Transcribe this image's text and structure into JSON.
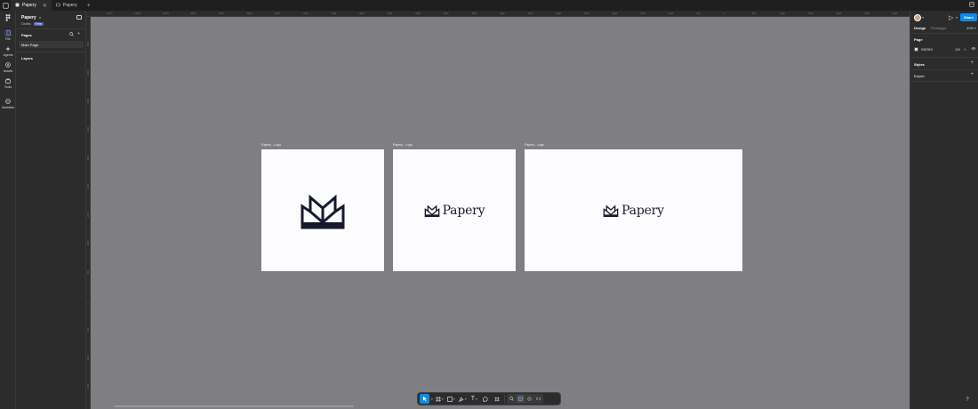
{
  "titlebar": {
    "tabs": [
      {
        "label": "Papery",
        "active": true
      },
      {
        "label": "Papery",
        "active": false
      }
    ]
  },
  "rail": {
    "items": [
      {
        "label": "File",
        "icon": "file-icon",
        "active": true
      },
      {
        "label": "Agents",
        "icon": "sparkle-icon"
      },
      {
        "label": "Assets",
        "icon": "assets-icon"
      },
      {
        "label": "Tools",
        "icon": "tools-icon"
      },
      {
        "label": "Variables",
        "icon": "variables-icon"
      }
    ]
  },
  "left_panel": {
    "project_name": "Papery",
    "drafts_label": "Drafts",
    "plan_badge": "Free",
    "pages_label": "Pages",
    "pages": [
      "Main Page"
    ],
    "layers_label": "Layers"
  },
  "ruler": {
    "h_ticks": [
      "-11000",
      "-10500",
      "-10000",
      "-9500",
      "-9000",
      "-8500",
      "-8000",
      "-7500",
      "-7000",
      "-6500",
      "-6000",
      "-5500",
      "-5000",
      "-4500",
      "-4000",
      "-3500",
      "-3000",
      "-2500",
      "-2000",
      "-1500",
      "-1000",
      "-500",
      "0",
      "500",
      "1000",
      "1500",
      "2000",
      "2500",
      "3000"
    ],
    "v_ticks": [
      "-4500",
      "-4000",
      "-3500",
      "-3000",
      "-2500",
      "-2000",
      "-1500",
      "-1000",
      "-500",
      "0",
      "500",
      "1000",
      "1500",
      "2000"
    ]
  },
  "canvas": {
    "frames": [
      {
        "label": "Papery - Logo",
        "variant": "mark"
      },
      {
        "label": "Papery - Logo",
        "variant": "wordmark",
        "word": "Papery"
      },
      {
        "label": "Papery - Logo",
        "variant": "wordmark",
        "word": "Papery"
      }
    ]
  },
  "toolbar": {
    "tools": [
      "move-tool",
      "frame-tool",
      "shape-tool",
      "pen-tool",
      "text-tool",
      "component-tool",
      "comment-tool"
    ],
    "text_tool_glyph": "T"
  },
  "right_panel": {
    "share_label": "Share",
    "tabs": [
      "Design",
      "Prototype"
    ],
    "zoom": "40%",
    "page_section": "Page",
    "page_color": "E5E5E5",
    "page_opacity": "100",
    "page_opacity_unit": "%",
    "styles_label": "Styles",
    "export_label": "Export"
  },
  "colors": {
    "canvas_bg": "#7f7e82",
    "accent": "#0c8ce9",
    "logo": "#161a2c",
    "frame_bg": "#fdfcfe"
  }
}
